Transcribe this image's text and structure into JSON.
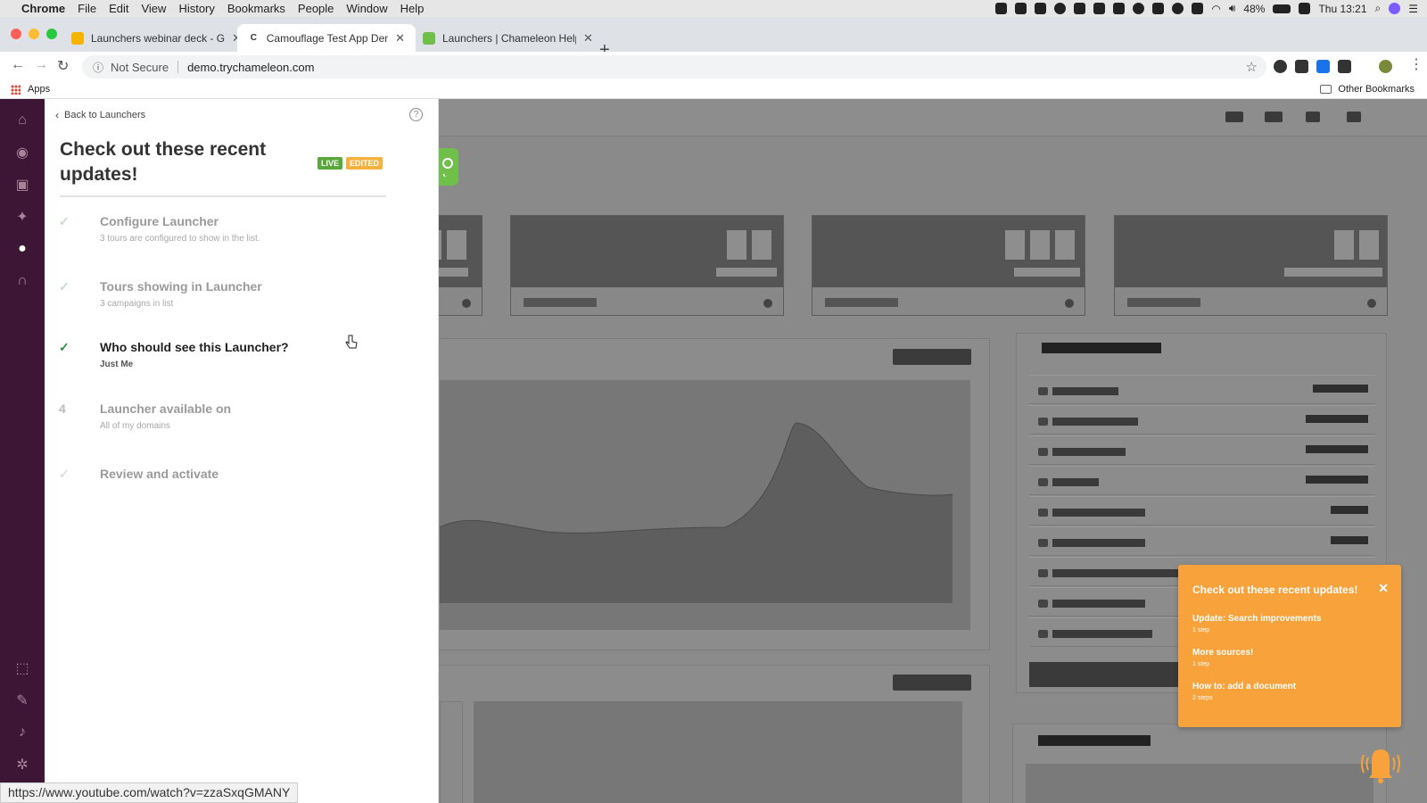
{
  "menubar": {
    "app": "Chrome",
    "items": [
      "File",
      "Edit",
      "View",
      "History",
      "Bookmarks",
      "People",
      "Window",
      "Help"
    ],
    "battery": "48%",
    "clock": "Thu 13:21"
  },
  "tabs": [
    {
      "label": "Launchers webinar deck - Goo",
      "favicon_color": "#f4b400",
      "favicon_text": ""
    },
    {
      "label": "Camouflage Test App Demo",
      "favicon_color": "#ffffff",
      "favicon_text": "C"
    },
    {
      "label": "Launchers | Chameleon Help C",
      "favicon_color": "#6fbf4a",
      "favicon_text": ""
    }
  ],
  "toolbar": {
    "security_label": "Not Secure",
    "url": "demo.trychameleon.com"
  },
  "bookmarks": {
    "apps_label": "Apps",
    "other_label": "Other Bookmarks"
  },
  "launcher_panel": {
    "back_label": "Back to Launchers",
    "help_icon": "?",
    "title": "Check out these recent updates!",
    "badge_live": "LIVE",
    "badge_edited": "EDITED",
    "steps": [
      {
        "mark": "✓",
        "title": "Configure Launcher",
        "subtitle": "3 tours are configured to show in the list."
      },
      {
        "mark": "✓",
        "title": "Tours showing in Launcher",
        "subtitle": "3 campaigns in list"
      },
      {
        "mark": "✓",
        "title": "Who should see this Launcher?",
        "subtitle": "Just Me"
      },
      {
        "mark": "4",
        "title": "Launcher available on",
        "subtitle": "All of my domains"
      },
      {
        "mark": "✓",
        "title": "Review and activate",
        "subtitle": ""
      }
    ]
  },
  "status_url": "https://www.youtube.com/watch?v=zzaSxqGMANY",
  "launcher_popup": {
    "title": "Check out these recent updates!",
    "close_icon": "✕",
    "items": [
      {
        "title": "Update: Search improvements",
        "meta": "1 step"
      },
      {
        "title": "More sources!",
        "meta": "1 step"
      },
      {
        "title": "How to: add a document",
        "meta": "2 steps"
      }
    ]
  },
  "colors": {
    "sidebar_bg": "#3c1634",
    "live_badge": "#5aa83c",
    "edited_badge": "#f7b13f",
    "popup_bg": "#f7a23a",
    "check_done": "#2e8b3f"
  }
}
